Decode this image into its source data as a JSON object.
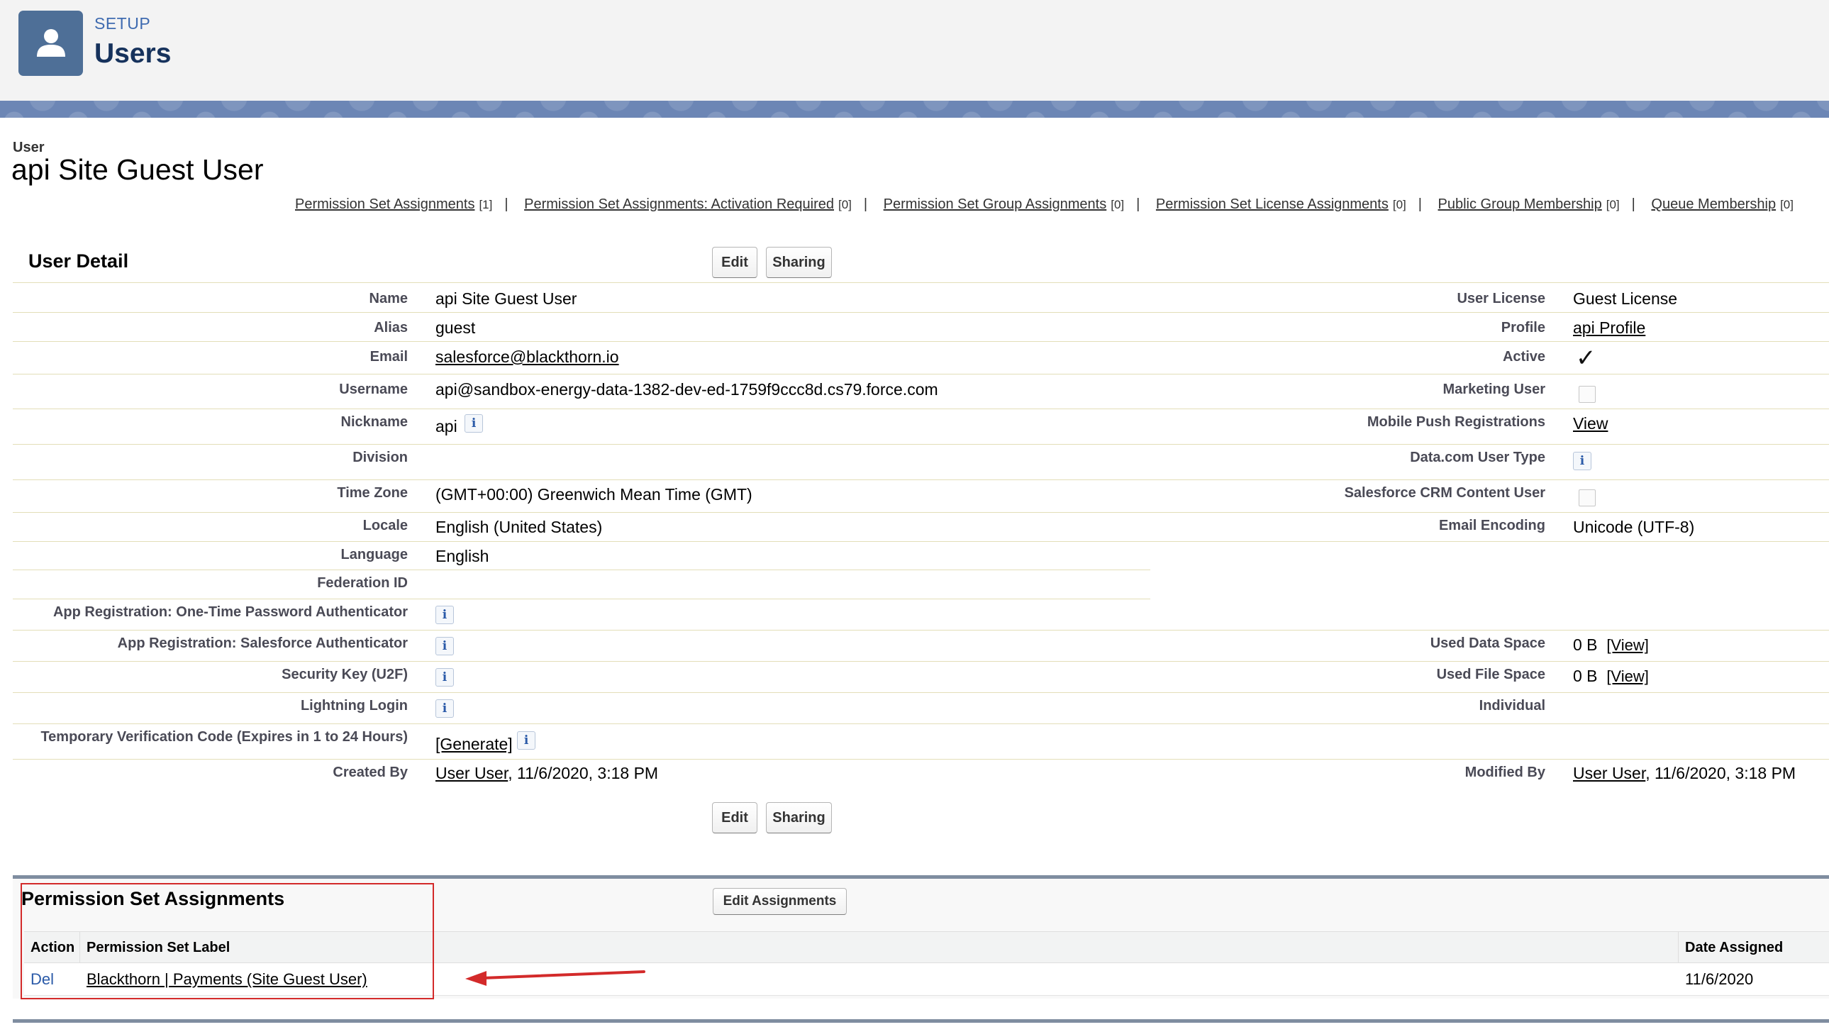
{
  "header": {
    "eyebrow": "SETUP",
    "title": "Users"
  },
  "record": {
    "type_label": "User",
    "name": "api Site Guest User"
  },
  "related_links": [
    {
      "label": "Permission Set Assignments",
      "count": "[1]"
    },
    {
      "label": "Permission Set Assignments: Activation Required",
      "count": "[0]"
    },
    {
      "label": "Permission Set Group Assignments",
      "count": "[0]"
    },
    {
      "label": "Permission Set License Assignments",
      "count": "[0]"
    },
    {
      "label": "Public Group Membership",
      "count": "[0]"
    },
    {
      "label": "Queue Membership",
      "count": "[0]"
    }
  ],
  "related_sep": "|",
  "detail": {
    "title": "User Detail",
    "edit_label": "Edit",
    "sharing_label": "Sharing",
    "left": {
      "name_label": "Name",
      "name_value": "api Site Guest User",
      "alias_label": "Alias",
      "alias_value": "guest",
      "email_label": "Email",
      "email_value": "salesforce@blackthorn.io",
      "username_label": "Username",
      "username_value": "api@sandbox-energy-data-1382-dev-ed-1759f9ccc8d.cs79.force.com",
      "nickname_label": "Nickname",
      "nickname_value": "api",
      "division_label": "Division",
      "timezone_label": "Time Zone",
      "timezone_value": "(GMT+00:00) Greenwich Mean Time (GMT)",
      "locale_label": "Locale",
      "locale_value": "English (United States)",
      "language_label": "Language",
      "language_value": "English",
      "federation_label": "Federation ID",
      "otp_label": "App Registration: One-Time Password Authenticator",
      "sfauth_label": "App Registration: Salesforce Authenticator",
      "u2f_label": "Security Key (U2F)",
      "lightning_label": "Lightning Login",
      "tempcode_label": "Temporary Verification Code (Expires in 1 to 24 Hours)",
      "generate_link": "[Generate]",
      "createdby_label": "Created By",
      "createdby_user": "User User",
      "createdby_date": ", 11/6/2020, 3:18 PM"
    },
    "right": {
      "license_label": "User License",
      "license_value": "Guest License",
      "profile_label": "Profile",
      "profile_value": "api Profile",
      "active_label": "Active",
      "active_mark": "✓",
      "marketing_label": "Marketing User",
      "mobilepush_label": "Mobile Push Registrations",
      "mobilepush_value": "View",
      "datacom_label": "Data.com User Type",
      "crm_label": "Salesforce CRM Content User",
      "encoding_label": "Email Encoding",
      "encoding_value": "Unicode (UTF-8)",
      "dataspace_label": "Used Data Space",
      "dataspace_value": "0 B",
      "filespace_label": "Used File Space",
      "filespace_value": "0 B",
      "view_link": "[View]",
      "individual_label": "Individual",
      "modifiedby_label": "Modified By",
      "modifiedby_user": "User User",
      "modifiedby_date": ", 11/6/2020, 3:18 PM"
    },
    "info_glyph": "i"
  },
  "permission_sets": {
    "title": "Permission Set Assignments",
    "edit_assignments_label": "Edit Assignments",
    "columns": [
      "Action",
      "Permission Set Label",
      "Date Assigned"
    ],
    "rows": [
      {
        "action": "Del",
        "label": "Blackthorn | Payments (Site Guest User)",
        "date": "11/6/2020"
      }
    ]
  },
  "colors": {
    "accent": "#4e6f97",
    "link_blue": "#2a5aa8",
    "annotation_red": "#d32a2a",
    "section_bar": "#7f8da0"
  }
}
